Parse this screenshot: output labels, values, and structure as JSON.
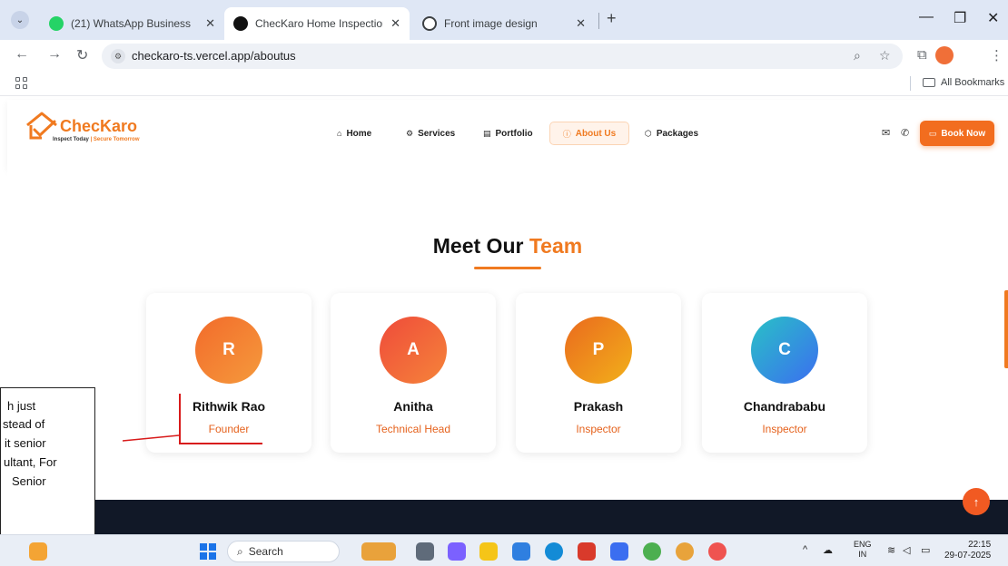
{
  "browser": {
    "tabs": [
      {
        "title": "(21) WhatsApp Business",
        "active": false,
        "favicon_color": "#25d366"
      },
      {
        "title": "ChecKaro Home Inspection - In",
        "active": true,
        "favicon_color": "#111111"
      },
      {
        "title": "Front image design",
        "active": false,
        "favicon_color": "#3c4043"
      }
    ],
    "url": "checkaro-ts.vercel.app/aboutus",
    "bookmarks_all": "All Bookmarks"
  },
  "site": {
    "logo_name": "ChecKaro",
    "logo_tagline_1": "Inspect Today",
    "logo_tagline_2": "| Secure",
    "logo_tagline_3": "Tomorrow",
    "nav": [
      {
        "label": "Home",
        "icon": "home-icon",
        "active": false
      },
      {
        "label": "Services",
        "icon": "gear-icon",
        "active": false
      },
      {
        "label": "Portfolio",
        "icon": "file-icon",
        "active": false
      },
      {
        "label": "About Us",
        "icon": "info-icon",
        "active": true
      },
      {
        "label": "Packages",
        "icon": "box-icon",
        "active": false
      }
    ],
    "book_now": "Book Now",
    "accent_color": "#f07a20"
  },
  "team": {
    "heading_main": "Meet Our",
    "heading_accent": "Team",
    "members": [
      {
        "initial": "R",
        "name": "Rithwik Rao",
        "role": "Founder",
        "gradient": [
          "#f26b2b",
          "#f59a3c"
        ]
      },
      {
        "initial": "A",
        "name": "Anitha",
        "role": "Technical Head",
        "gradient": [
          "#ef4b3a",
          "#f5843a"
        ]
      },
      {
        "initial": "P",
        "name": "Prakash",
        "role": "Inspector",
        "gradient": [
          "#ea6a1e",
          "#f2b01a"
        ]
      },
      {
        "initial": "C",
        "name": "Chandrababu",
        "role": "Inspector",
        "gradient": [
          "#29c1c6",
          "#3b6ef0"
        ]
      }
    ]
  },
  "annotation": {
    "lines": [
      "h just",
      "stead of",
      "it senior",
      "ultant, For",
      "Senior"
    ]
  },
  "taskbar": {
    "search_placeholder": "Search",
    "lang_1": "ENG",
    "lang_2": "IN",
    "time": "22:15",
    "date": "29-07-2025"
  }
}
